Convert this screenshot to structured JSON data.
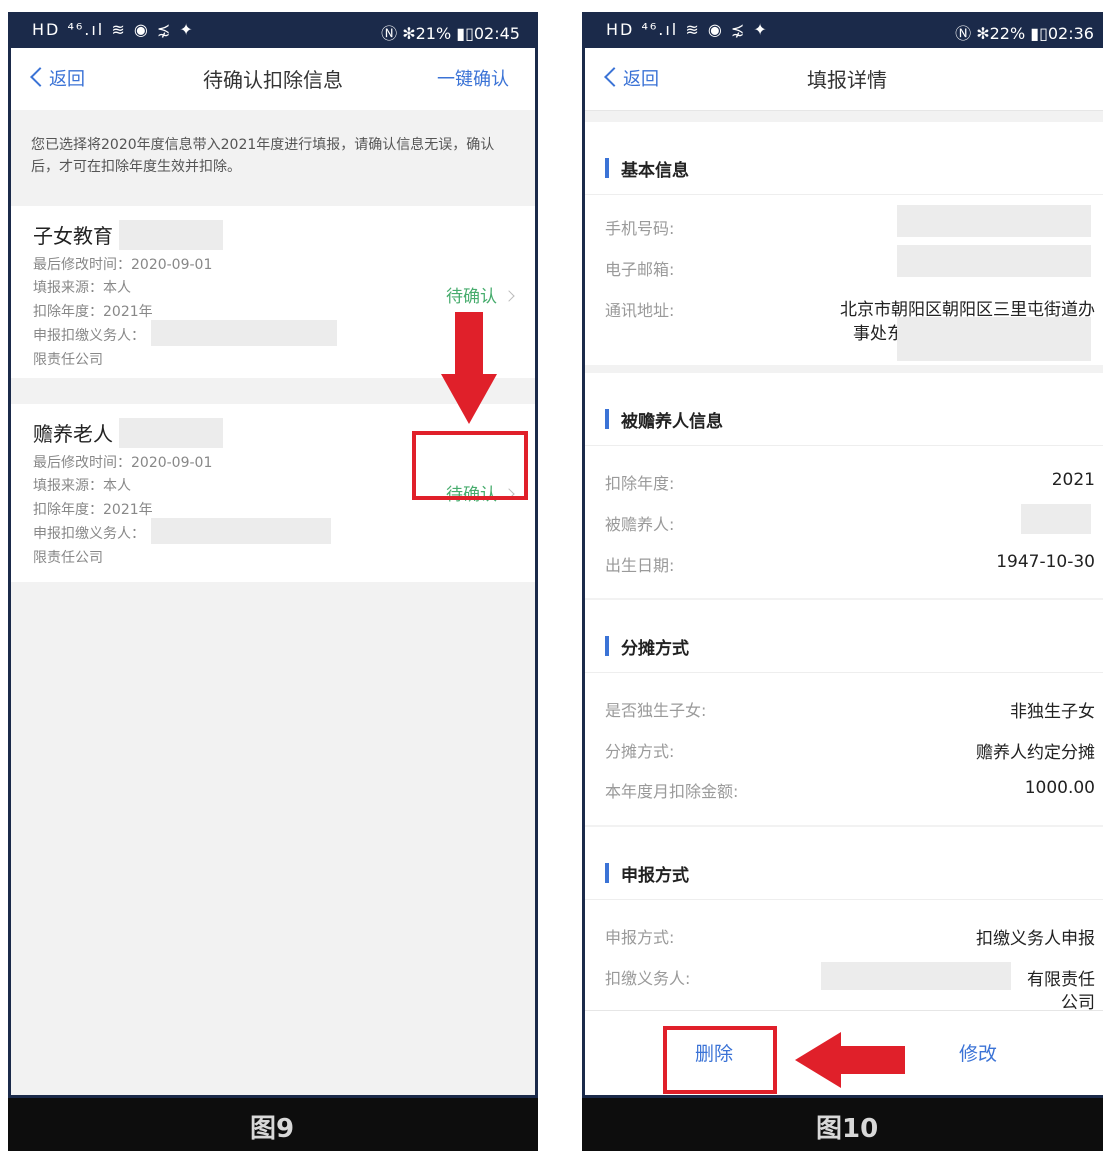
{
  "left": {
    "status": {
      "left": "HD ⁴⁶.ıl ≋ ◉ ⋨ ✦",
      "right": "Ⓝ ✻21% ▮▯02:45"
    },
    "nav": {
      "back": "返回",
      "title": "待确认扣除信息",
      "action": "一键确认"
    },
    "notice": "您已选择将2020年度信息带入2021年度进行填报，请确认信息无误，确认后，才可在扣除年度生效并扣除。",
    "cards": [
      {
        "title": "子女教育",
        "modified": "最后修改时间：2020-09-01",
        "source": "填报来源：本人",
        "year": "扣除年度：2021年",
        "agent": "申报扣缴义务人：",
        "company": "限责任公司",
        "status": "待确认"
      },
      {
        "title": "赡养老人",
        "modified": "最后修改时间：2020-09-01",
        "source": "填报来源：本人",
        "year": "扣除年度：2021年",
        "agent": "申报扣缴义务人：",
        "company": "限责任公司",
        "status": "待确认"
      }
    ],
    "caption": "图9"
  },
  "right": {
    "status": {
      "left": "HD ⁴⁶.ıl ≋ ◉ ⋨ ✦",
      "right": "Ⓝ ✻22% ▮▯02:36"
    },
    "nav": {
      "back": "返回",
      "title": "填报详情"
    },
    "basic": {
      "title": "基本信息",
      "phone_label": "手机号码:",
      "email_label": "电子邮箱:",
      "address_label": "通讯地址:",
      "address_line1": "北京市朝阳区朝阳区三里屯街道办",
      "address_line2": "事处东大"
    },
    "supported": {
      "title": "被赡养人信息",
      "year_label": "扣除年度:",
      "year_value": "2021",
      "person_label": "被赡养人:",
      "birth_label": "出生日期:",
      "birth_value": "1947-10-30"
    },
    "split": {
      "title": "分摊方式",
      "only_child_label": "是否独生子女:",
      "only_child_value": "非独生子女",
      "method_label": "分摊方式:",
      "method_value": "赡养人约定分摊",
      "amount_label": "本年度月扣除金额:",
      "amount_value": "1000.00"
    },
    "report": {
      "title": "申报方式",
      "method_label": "申报方式:",
      "method_value": "扣缴义务人申报",
      "agent_label": "扣缴义务人:",
      "agent_line1": "有限责任",
      "agent_line2": "公司"
    },
    "actions": {
      "delete": "删除",
      "edit": "修改"
    },
    "caption": "图10"
  },
  "colors": {
    "accent_blue": "#3b73d6",
    "pending_green": "#47ac6d",
    "highlight_red": "#e0202a",
    "frame_navy": "#1b2a4a"
  },
  "icons": [
    "chevron-left-icon",
    "chevron-right-icon",
    "down-arrow-icon",
    "left-arrow-icon"
  ]
}
